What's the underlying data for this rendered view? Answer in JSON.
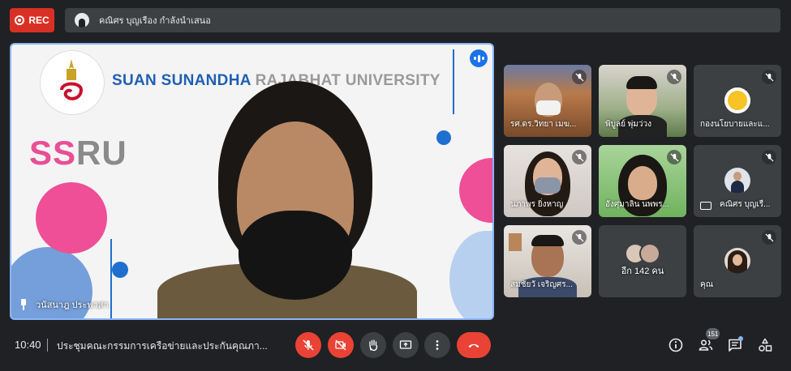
{
  "topbar": {
    "rec_label": "REC",
    "presenting_text": "คณิศร บุญเรือง กำลังนำเสนอ"
  },
  "stage": {
    "university_name_main": "SUAN SUNANDHA",
    "university_name_faded": "RAJABHAT UNIVERSITY",
    "ssru_pink": "SS",
    "ssru_grey": "RU",
    "presenter_name": "วนัสนาฎ ประพาสา"
  },
  "tiles": [
    {
      "name": "รศ.ดร.วิทยา เมฆ...",
      "muted": true
    },
    {
      "name": "พิบูลย์ พุ่มว่วง",
      "muted": true
    },
    {
      "name": "กองนโยบายและแ...",
      "muted": true
    },
    {
      "name": "นภาพร ยิ่งหาญ",
      "muted": true
    },
    {
      "name": "อังศุมาลิน นพพร...",
      "muted": true
    },
    {
      "name": "คณิศร บุญเรื...",
      "muted": true
    },
    {
      "name": "สมชัยวั เจริญศร...",
      "muted": true
    },
    {
      "name": "อีก 142 คน",
      "muted": false
    },
    {
      "name": "คุณ",
      "muted": true
    }
  ],
  "bottombar": {
    "time": "10:40",
    "meeting_title": "ประชุมคณะกรรมการเครือข่ายและประกันคุณภา...",
    "participants_count": "151"
  },
  "colors": {
    "accent_blue": "#8ab4f8",
    "rec_red": "#d93025",
    "control_red": "#ea4335",
    "bg": "#202124",
    "surface": "#3c4043"
  }
}
